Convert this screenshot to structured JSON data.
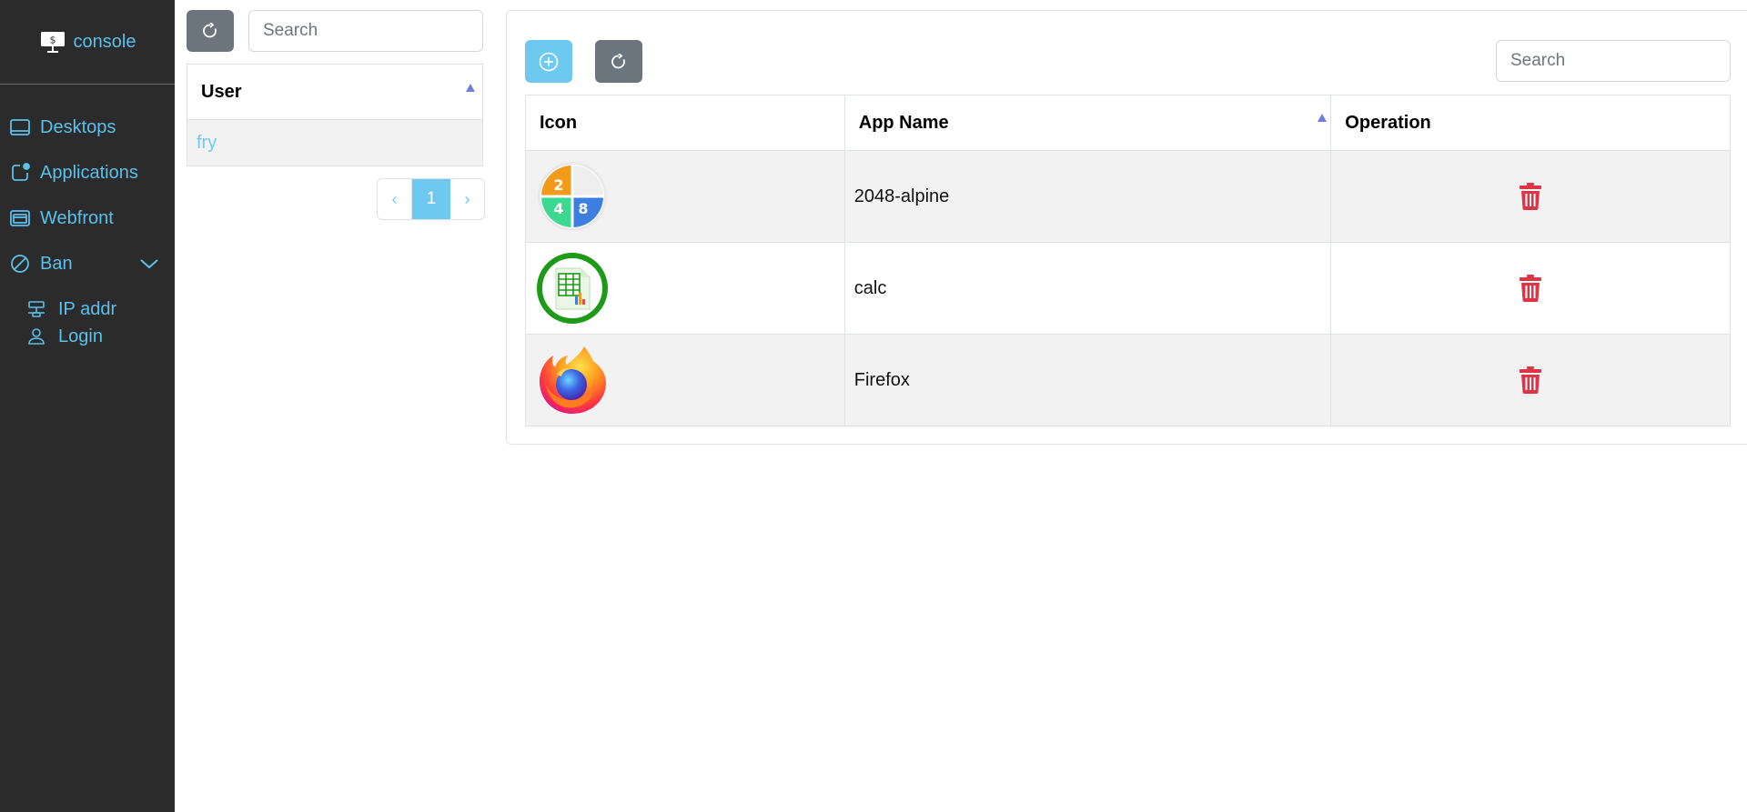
{
  "brand": {
    "label": "console",
    "icon": "monitor-dollar-icon"
  },
  "sidebar": {
    "items": [
      {
        "label": "Desktops",
        "icon": "desktop-icon"
      },
      {
        "label": "Applications",
        "icon": "app-badge-icon"
      },
      {
        "label": "Webfront",
        "icon": "browser-window-icon"
      },
      {
        "label": "Ban",
        "icon": "ban-circle-icon",
        "expanded": true
      }
    ],
    "subitems": [
      {
        "label": "IP addr",
        "icon": "ethernet-icon"
      },
      {
        "label": "Login",
        "icon": "person-icon"
      }
    ]
  },
  "users": {
    "search_placeholder": "Search",
    "column": "User",
    "rows": [
      {
        "name": "fry"
      }
    ],
    "pager": {
      "prev": "‹",
      "current": "1",
      "next": "›"
    }
  },
  "apps": {
    "search_placeholder": "Search",
    "columns": {
      "icon": "Icon",
      "name": "App Name",
      "operation": "Operation"
    },
    "sorted_column": "App Name",
    "rows": [
      {
        "name": "2048-alpine",
        "icon": "2048-game-icon"
      },
      {
        "name": "calc",
        "icon": "calc-spreadsheet-icon"
      },
      {
        "name": "Firefox",
        "icon": "firefox-icon"
      }
    ],
    "icon_2048_digits": [
      "2",
      "4",
      "8"
    ]
  },
  "colors": {
    "sidebar_bg": "#2b2b2b",
    "accent": "#5bc0eb",
    "primary_button": "#6ec9f0",
    "secondary_button": "#6c757d",
    "danger": "#dc3545",
    "sort_indicator": "#6f7fe0"
  }
}
